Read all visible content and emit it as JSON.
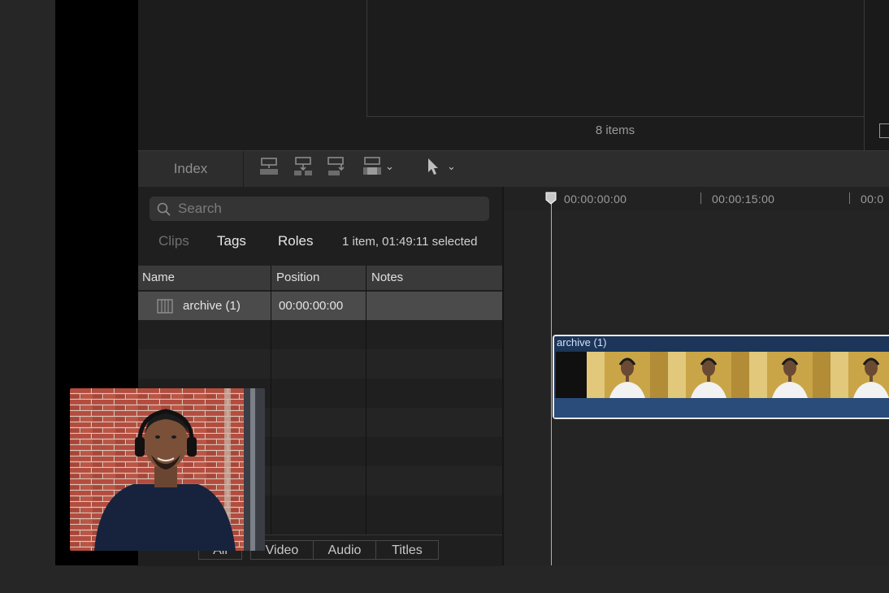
{
  "browser": {
    "items_count": "8 items"
  },
  "toolbar": {
    "index_label": "Index",
    "tools": [
      "connect-clip-icon",
      "insert-clip-icon",
      "append-clip-icon",
      "overwrite-clip-icon",
      "select-tool-icon"
    ]
  },
  "index_panel": {
    "search_placeholder": "Search",
    "segments": [
      "Clips",
      "Tags",
      "Roles"
    ],
    "active_segment": "Tags",
    "selection_info": "1 item, 01:49:11 selected",
    "columns": [
      "Name",
      "Position",
      "Notes"
    ],
    "rows": [
      {
        "name": "archive (1)",
        "position": "00:00:00:00",
        "notes": ""
      }
    ],
    "bottom_tabs": [
      "All",
      "Video",
      "Audio",
      "Titles"
    ]
  },
  "timeline": {
    "timecodes": [
      "00:00:00:00",
      "00:00:15:00",
      "00:0"
    ],
    "clip_title": "archive (1)"
  },
  "colors": {
    "clip_fill": "#1c3558",
    "clip_audio": "#2a4c7a",
    "background": "#262626"
  }
}
